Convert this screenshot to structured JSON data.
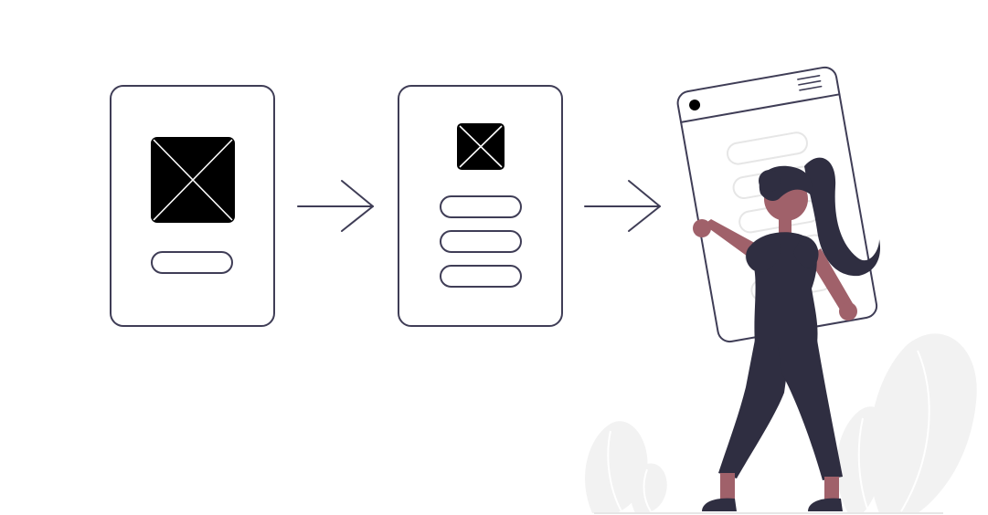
{
  "illustration": {
    "colors": {
      "outline": "#3f3d56",
      "image_placeholder_fill": "#000000",
      "image_placeholder_cross": "#ffffff",
      "figure_dark": "#2f2e41",
      "figure_skin": "#a0616a",
      "foliage": "#f2f2f2",
      "foliage_lines": "#ffffff",
      "ground_line": "#e6e6e6",
      "device_field": "#e6e6e6",
      "background": "#ffffff"
    },
    "wireframe_1": {
      "icon": "image-placeholder-icon",
      "button_count": 1
    },
    "wireframe_2": {
      "icon": "image-placeholder-icon",
      "button_count": 3
    },
    "arrows": [
      "arrow-right-icon",
      "arrow-right-icon"
    ],
    "device": {
      "icons": [
        "camera-dot-icon",
        "hamburger-menu-icon"
      ],
      "field_count": 5
    },
    "person": "woman-holding-device",
    "plants": [
      "leaf-plant-left",
      "leaf-plant-right"
    ]
  }
}
